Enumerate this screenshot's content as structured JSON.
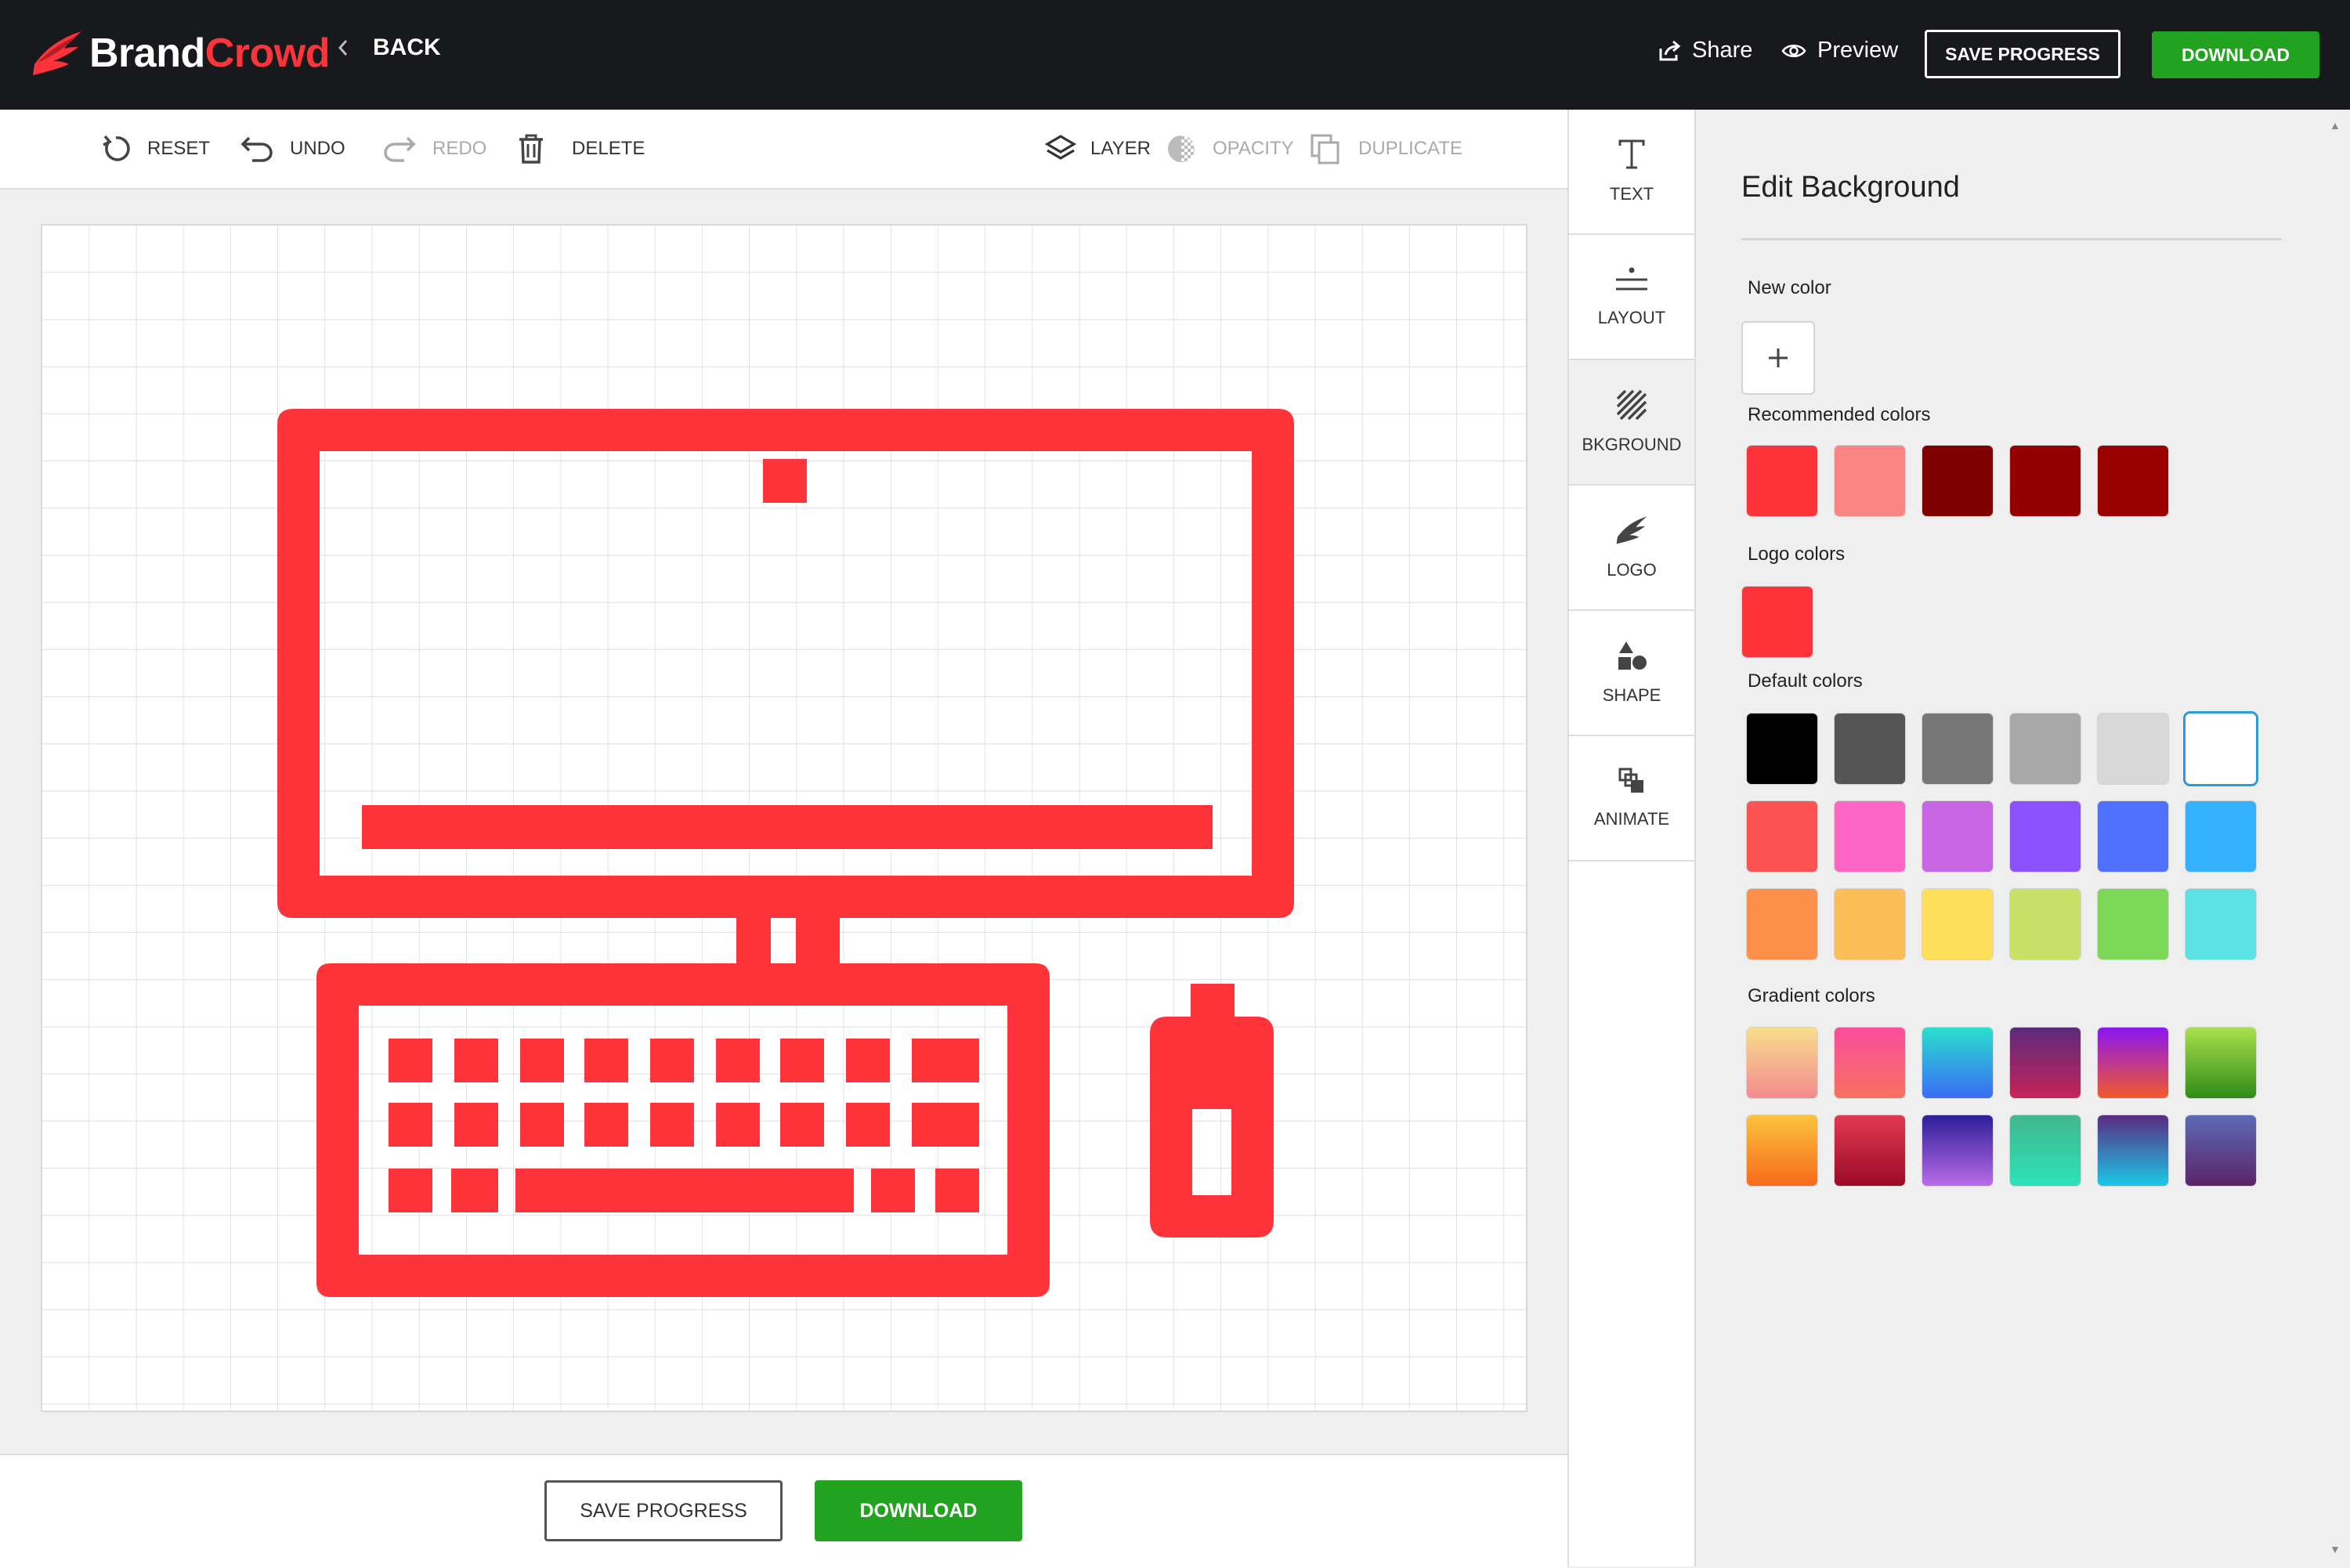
{
  "brand": {
    "name_part1": "Brand",
    "name_part2": "Crowd",
    "accent": "#ff343a"
  },
  "header": {
    "back_label": "BACK",
    "share_label": "Share",
    "preview_label": "Preview",
    "save_label": "SAVE PROGRESS",
    "download_label": "DOWNLOAD"
  },
  "toolbar": {
    "reset_label": "RESET",
    "undo_label": "UNDO",
    "redo_label": "REDO",
    "delete_label": "DELETE",
    "layer_label": "LAYER",
    "opacity_label": "OPACITY",
    "duplicate_label": "DUPLICATE"
  },
  "footer": {
    "save_label": "SAVE PROGRESS",
    "download_label": "DOWNLOAD"
  },
  "menu": {
    "items": [
      {
        "label": "TEXT",
        "icon": "text-icon"
      },
      {
        "label": "LAYOUT",
        "icon": "layout-icon"
      },
      {
        "label": "BKGROUND",
        "icon": "background-icon",
        "active": true
      },
      {
        "label": "LOGO",
        "icon": "logo-icon"
      },
      {
        "label": "SHAPE",
        "icon": "shape-icon"
      },
      {
        "label": "ANIMATE",
        "icon": "animate-icon"
      }
    ]
  },
  "panel": {
    "title": "Edit Background",
    "new_color_label": "New color",
    "recommended_label": "Recommended colors",
    "logo_colors_label": "Logo colors",
    "default_label": "Default colors",
    "gradient_label": "Gradient colors",
    "recommended_colors": [
      "#ff343a",
      "#fb8583",
      "#800000",
      "#940000",
      "#9a0000"
    ],
    "logo_colors": [
      "#ff343a"
    ],
    "default_colors": [
      "#000000",
      "#555555",
      "#777777",
      "#a8a8a8",
      "#d8d8d8",
      "#ffffff",
      "#fd5453",
      "#fe66c5",
      "#c865e3",
      "#8c52fe",
      "#5071fe",
      "#34b2fe",
      "#fe914a",
      "#fdbd59",
      "#fedf59",
      "#c9e166",
      "#7dd858",
      "#5ae1e3"
    ],
    "selected_default": "#ffffff",
    "gradient_colors": [
      [
        "#f7de8c",
        "#f48a8e"
      ],
      [
        "#fa4d9d",
        "#f8715f"
      ],
      [
        "#2be0d0",
        "#3a6cf3"
      ],
      [
        "#5b2a7b",
        "#c6245a"
      ],
      [
        "#8a16f2",
        "#f25a2c"
      ],
      [
        "#a8e04d",
        "#2f8c17"
      ],
      [
        "#fbc33e",
        "#f86a1c"
      ],
      [
        "#e23952",
        "#9c0a26"
      ],
      [
        "#2e1e9b",
        "#b86be6"
      ],
      [
        "#41b78f",
        "#2de2b7"
      ],
      [
        "#5a2a82",
        "#19c9e6"
      ],
      [
        "#5c6ab5",
        "#5c2468"
      ]
    ]
  },
  "artwork": {
    "color": "#ff343a",
    "description_icon": "desktop-computer-icon"
  }
}
